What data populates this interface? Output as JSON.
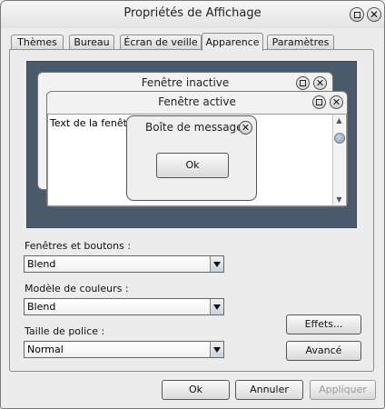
{
  "window": {
    "title": "Propriétés de Affichage"
  },
  "tabs": [
    "Thèmes",
    "Bureau",
    "Écran de veille",
    "Apparence",
    "Paramètres"
  ],
  "active_tab": "Apparence",
  "preview": {
    "inactive_title": "Fenêtre inactive",
    "active_title": "Fenêtre active",
    "window_text": "Text de la fenêtre",
    "message_box": {
      "title": "Boîte de message",
      "ok_label": "Ok"
    }
  },
  "form": {
    "windows_buttons": {
      "label": "Fenêtres et boutons :",
      "value": "Blend"
    },
    "color_scheme": {
      "label": "Modèle de couleurs :",
      "value": "Blend"
    },
    "font_size": {
      "label": "Taille de police :",
      "value": "Normal"
    },
    "effects_label": "Effets...",
    "advanced_label": "Avancé"
  },
  "footer": {
    "ok_label": "Ok",
    "cancel_label": "Annuler",
    "apply_label": "Appliquer"
  },
  "icons": [
    "maximize-icon",
    "close-icon",
    "dropdown-arrow-icon",
    "scroll-up-icon",
    "scroll-down-icon"
  ]
}
